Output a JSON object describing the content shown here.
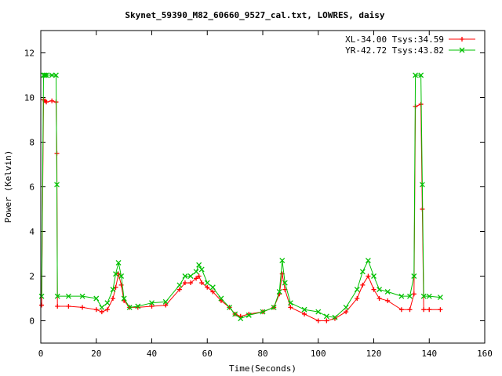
{
  "chart_data": {
    "type": "line",
    "title": "Skynet_59390_M82_60660_9527_cal.txt, LOWRES, daisy",
    "xlabel": "Time(Seconds)",
    "ylabel": "Power (Kelvin)",
    "xlim": [
      0,
      160
    ],
    "ylim": [
      -1,
      13
    ],
    "x_ticks": [
      0,
      20,
      40,
      60,
      80,
      100,
      120,
      140,
      160
    ],
    "y_ticks": [
      0,
      2,
      4,
      6,
      8,
      10,
      12
    ],
    "x_tick_labels": [
      "0",
      "20",
      "40",
      "60",
      "80",
      "100",
      "120",
      "140",
      "160"
    ],
    "y_tick_labels": [
      "0",
      "2",
      "4",
      "6",
      "8",
      "10",
      "12"
    ],
    "grid": false,
    "legend_position": "top-right",
    "series": [
      {
        "name": "XL-34.00 Tsys:34.59",
        "color": "#ff0000",
        "marker": "plus",
        "x": [
          0.3,
          1,
          1.5,
          2,
          4,
          5.5,
          5.8,
          6,
          10,
          15,
          20,
          22,
          24,
          26,
          27,
          28,
          29,
          30,
          32,
          35,
          40,
          45,
          50,
          52,
          54,
          56,
          57,
          58,
          60,
          62,
          65,
          68,
          70,
          72,
          75,
          80,
          84,
          86,
          87,
          88,
          90,
          95,
          100,
          103,
          106,
          110,
          114,
          116,
          118,
          120,
          122,
          125,
          130,
          133,
          134.5,
          135,
          137,
          137.5,
          138,
          140,
          144
        ],
        "y": [
          0.7,
          9.9,
          9.85,
          9.8,
          9.85,
          9.8,
          7.5,
          0.65,
          0.65,
          0.6,
          0.5,
          0.4,
          0.5,
          1.0,
          1.5,
          2.1,
          1.6,
          0.9,
          0.6,
          0.6,
          0.65,
          0.7,
          1.4,
          1.7,
          1.7,
          1.9,
          2.0,
          1.7,
          1.5,
          1.3,
          0.9,
          0.6,
          0.3,
          0.2,
          0.3,
          0.4,
          0.6,
          1.2,
          2.1,
          1.4,
          0.6,
          0.3,
          0.0,
          0.0,
          0.1,
          0.4,
          1.0,
          1.6,
          2.0,
          1.4,
          1.0,
          0.9,
          0.5,
          0.5,
          1.2,
          9.6,
          9.7,
          5.0,
          0.5,
          0.5,
          0.5
        ]
      },
      {
        "name": "YR-42.72 Tsys:43.82",
        "color": "#00c000",
        "marker": "cross",
        "x": [
          0.3,
          1,
          1.5,
          2,
          4,
          5.5,
          5.8,
          6,
          10,
          15,
          20,
          22,
          24,
          26,
          27,
          28,
          29,
          30,
          32,
          35,
          40,
          45,
          50,
          52,
          54,
          56,
          57,
          58,
          60,
          62,
          65,
          68,
          70,
          72,
          75,
          80,
          84,
          86,
          87,
          88,
          90,
          95,
          100,
          103,
          106,
          110,
          114,
          116,
          118,
          120,
          122,
          125,
          130,
          133,
          134.5,
          135,
          137,
          137.5,
          138,
          140,
          144
        ],
        "y": [
          1.1,
          11.0,
          11.0,
          11.0,
          11.0,
          11.0,
          6.1,
          1.1,
          1.1,
          1.1,
          1.0,
          0.6,
          0.8,
          1.4,
          2.1,
          2.6,
          2.0,
          1.0,
          0.6,
          0.65,
          0.8,
          0.85,
          1.6,
          2.0,
          2.0,
          2.2,
          2.5,
          2.3,
          1.7,
          1.5,
          1.0,
          0.6,
          0.3,
          0.1,
          0.25,
          0.4,
          0.6,
          1.3,
          2.7,
          1.7,
          0.8,
          0.5,
          0.4,
          0.2,
          0.15,
          0.6,
          1.4,
          2.2,
          2.7,
          2.0,
          1.4,
          1.3,
          1.1,
          1.1,
          2.0,
          11.0,
          11.0,
          6.1,
          1.1,
          1.1,
          1.05
        ]
      }
    ]
  }
}
